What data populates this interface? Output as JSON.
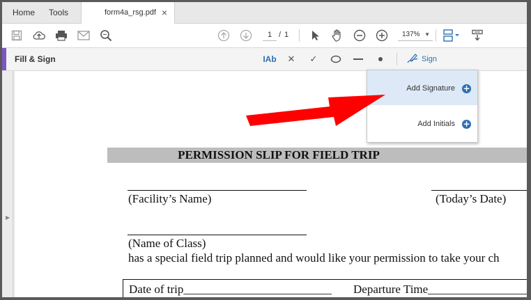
{
  "tabs": {
    "home": "Home",
    "tools": "Tools",
    "document": "form4a_rsg.pdf",
    "close": "×"
  },
  "toolbar": {
    "current_page": "1",
    "page_separator": "/",
    "total_pages": "1",
    "zoom": "137%",
    "icons": [
      "save-icon",
      "upload-icon",
      "print-icon",
      "email-icon",
      "search-icon",
      "page-up-icon",
      "page-down-icon",
      "select-cursor-icon",
      "hand-icon",
      "zoom-out-icon",
      "zoom-in-icon",
      "page-view-icon",
      "scroll-mode-icon"
    ]
  },
  "fill_sign": {
    "title": "Fill & Sign",
    "text_tool": "IAb",
    "cross_tool": "✕",
    "check_tool": "✓",
    "sign_label": "Sign",
    "accent_color": "#7e57c2"
  },
  "sign_menu": {
    "items": [
      {
        "label": "Add Signature"
      },
      {
        "label": "Add Initials"
      }
    ],
    "plus": "+"
  },
  "document": {
    "heading": "PERMISSION SLIP FOR FIELD TRIP",
    "facility_name": "(Facility’s Name)",
    "todays_date": "(Today’s Date)",
    "name_of_class": "(Name of Class)",
    "sentence": "has a special field trip planned and would like your permission to take your ch",
    "date_of_trip": "Date of trip_________________________",
    "departure_time": "Departure Time_____________________"
  },
  "colors": {
    "accent_blue": "#2d6fb5",
    "arrow_red": "#ff0000",
    "heading_bar": "#bdbdbd"
  }
}
